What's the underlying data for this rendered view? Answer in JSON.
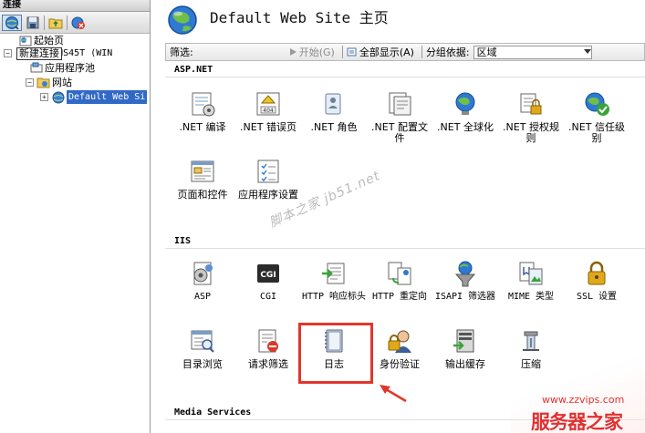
{
  "left_pane": {
    "header": "连接",
    "tooltip": "新建连接",
    "tree": [
      {
        "label": "起始页",
        "icon": "start-page-icon"
      },
      {
        "label": "WS-TONS45T (WIN",
        "icon": "server-icon",
        "expander": "−"
      },
      {
        "label": "应用程序池",
        "icon": "app-pool-icon"
      },
      {
        "label": "网站",
        "icon": "sites-folder-icon",
        "expander": "−"
      },
      {
        "label": "Default Web Si",
        "icon": "globe-icon",
        "expander": "+"
      }
    ]
  },
  "main": {
    "title": "Default Web Site 主页",
    "filter": {
      "label": "筛选:",
      "start_label": "开始(G)",
      "show_all_label": "全部显示(A)",
      "group_by_label": "分组依据:",
      "group_by_value": "区域"
    },
    "sections": [
      {
        "title": "ASP.NET",
        "items": [
          {
            "label": ".NET 编译",
            "icon": "net-compilation-icon"
          },
          {
            "label": ".NET 错误页",
            "icon": "net-error-pages-icon"
          },
          {
            "label": ".NET 角色",
            "icon": "net-roles-icon"
          },
          {
            "label": ".NET 配置文件",
            "icon": "net-profile-icon"
          },
          {
            "label": ".NET 全球化",
            "icon": "net-globalization-icon"
          },
          {
            "label": ".NET 授权规则",
            "icon": "net-authorization-icon"
          },
          {
            "label": ".NET 信任级别",
            "icon": "net-trust-levels-icon"
          },
          {
            "label": "页面和控件",
            "icon": "pages-controls-icon"
          },
          {
            "label": "应用程序设置",
            "icon": "app-settings-icon"
          }
        ]
      },
      {
        "title": "IIS",
        "items": [
          {
            "label": "ASP",
            "icon": "asp-icon"
          },
          {
            "label": "CGI",
            "icon": "cgi-icon"
          },
          {
            "label": "HTTP 响应标头",
            "icon": "http-headers-icon"
          },
          {
            "label": "HTTP 重定向",
            "icon": "http-redirect-icon"
          },
          {
            "label": "ISAPI 筛选器",
            "icon": "isapi-filters-icon"
          },
          {
            "label": "MIME 类型",
            "icon": "mime-types-icon"
          },
          {
            "label": "SSL 设置",
            "icon": "ssl-settings-icon"
          },
          {
            "label": "目录浏览",
            "icon": "directory-browsing-icon"
          },
          {
            "label": "请求筛选",
            "icon": "request-filtering-icon"
          },
          {
            "label": "日志",
            "icon": "logging-icon"
          },
          {
            "label": "身份验证",
            "icon": "authentication-icon"
          },
          {
            "label": "输出缓存",
            "icon": "output-caching-icon"
          },
          {
            "label": "压缩",
            "icon": "compression-icon"
          }
        ]
      },
      {
        "title": "Media Services",
        "items": []
      }
    ]
  },
  "watermark": "脚本之家 jb51.net",
  "brand": {
    "url": "www.zzvips.com",
    "name": "服务器之家"
  },
  "colors": {
    "highlight": "#e2362b",
    "selection": "#3169c6"
  }
}
